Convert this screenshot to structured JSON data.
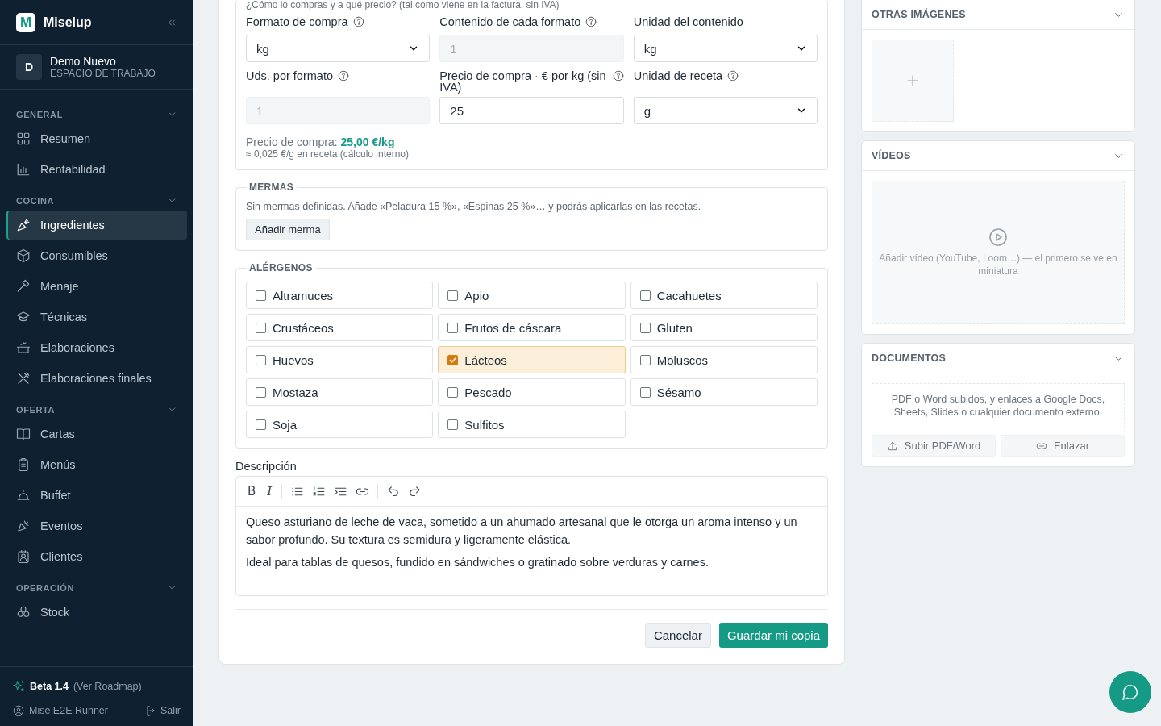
{
  "sidebar": {
    "brand": {
      "logo_letter": "M",
      "name": "Miselup"
    },
    "workspace": {
      "initial": "D",
      "name": "Demo Nuevo",
      "subtitle": "ESPACIO DE TRABAJO"
    },
    "sections": [
      {
        "title": "GENERAL",
        "expanded": true,
        "items": [
          {
            "label": "Resumen",
            "selected": false
          },
          {
            "label": "Rentabilidad",
            "selected": false
          }
        ]
      },
      {
        "title": "COCINA",
        "expanded": true,
        "items": [
          {
            "label": "Ingredientes",
            "selected": true
          },
          {
            "label": "Consumibles",
            "selected": false
          },
          {
            "label": "Menaje",
            "selected": false
          },
          {
            "label": "Técnicas",
            "selected": false
          },
          {
            "label": "Elaboraciones",
            "selected": false
          },
          {
            "label": "Elaboraciones finales",
            "selected": false
          }
        ]
      },
      {
        "title": "OFERTA",
        "expanded": true,
        "items": [
          {
            "label": "Cartas",
            "selected": false
          },
          {
            "label": "Menús",
            "selected": false
          },
          {
            "label": "Buffet",
            "selected": false
          },
          {
            "label": "Eventos",
            "selected": false
          },
          {
            "label": "Clientes",
            "selected": false
          }
        ]
      },
      {
        "title": "OPERACIÓN",
        "expanded": true,
        "items": [
          {
            "label": "Stock",
            "selected": false
          }
        ]
      }
    ],
    "footer": {
      "version_label": "Beta 1.4",
      "roadmap_link": "(Ver Roadmap)",
      "user": "Mise E2E Runner",
      "logout": "Salir"
    }
  },
  "purchase": {
    "hint": "¿Cómo lo compras y a qué precio? (tal como viene en la factura, sin IVA)",
    "fields": [
      {
        "kind": "select",
        "label": "Formato de compra",
        "help": true,
        "value": "kg",
        "disabled": false
      },
      {
        "kind": "input",
        "label": "Contenido de cada formato",
        "help": true,
        "value": "1",
        "disabled": true
      },
      {
        "kind": "select",
        "label": "Unidad del contenido",
        "help": false,
        "value": "kg",
        "disabled": false
      },
      {
        "kind": "input",
        "label": "Uds. por formato",
        "help": true,
        "value": "1",
        "disabled": true
      },
      {
        "kind": "input",
        "label": "Precio de compra · € por kg (sin IVA)",
        "help": true,
        "value": "25",
        "disabled": false
      },
      {
        "kind": "select",
        "label": "Unidad de receta",
        "help": true,
        "value": "g",
        "disabled": false
      }
    ],
    "summary_label": "Precio de compra:",
    "summary_value": "25,00 €/kg",
    "summary_note": "≈ 0,025 €/g en receta (cálculo interno)"
  },
  "mermas": {
    "title": "MERMAS",
    "empty_text": "Sin mermas definidas. Añade «Peladura 15 %», «Espinas 25 %»… y podrás aplicarlas en las recetas.",
    "add_button": "Añadir merma"
  },
  "allergens": {
    "title": "ALÉRGENOS",
    "items": [
      {
        "label": "Altramuces",
        "checked": false
      },
      {
        "label": "Apio",
        "checked": false
      },
      {
        "label": "Cacahuetes",
        "checked": false
      },
      {
        "label": "Crustáceos",
        "checked": false
      },
      {
        "label": "Frutos de cáscara",
        "checked": false
      },
      {
        "label": "Gluten",
        "checked": false
      },
      {
        "label": "Huevos",
        "checked": false
      },
      {
        "label": "Lácteos",
        "checked": true
      },
      {
        "label": "Moluscos",
        "checked": false
      },
      {
        "label": "Mostaza",
        "checked": false
      },
      {
        "label": "Pescado",
        "checked": false
      },
      {
        "label": "Sésamo",
        "checked": false
      },
      {
        "label": "Soja",
        "checked": false
      },
      {
        "label": "Sulfitos",
        "checked": false
      }
    ]
  },
  "description": {
    "label": "Descripción",
    "format_labels": [
      "B",
      "I"
    ],
    "paragraphs": [
      "Queso asturiano de leche de vaca, sometido a un ahumado artesanal que le otorga un aroma intenso y un sabor profundo. Su textura es semidura y ligeramente elástica.",
      "Ideal para tablas de quesos, fundido en sándwiches o gratinado sobre verduras y carnes."
    ]
  },
  "actions": {
    "cancel": "Cancelar",
    "save": "Guardar mi copia"
  },
  "panels": [
    {
      "kind": "images",
      "title": "OTRAS IMÁGENES",
      "expanded": true
    },
    {
      "kind": "videos",
      "title": "VÍDEOS",
      "expanded": true,
      "placeholder": "Añadir vídeo (YouTube, Loom…) — el primero se ve en miniatura"
    },
    {
      "kind": "documents",
      "title": "DOCUMENTOS",
      "expanded": true,
      "note": "PDF o Word subidos, y enlaces a Google Docs, Sheets, Slides o cualquier documento externo.",
      "buttons": [
        "Subir PDF/Word",
        "Enlazar"
      ]
    }
  ]
}
